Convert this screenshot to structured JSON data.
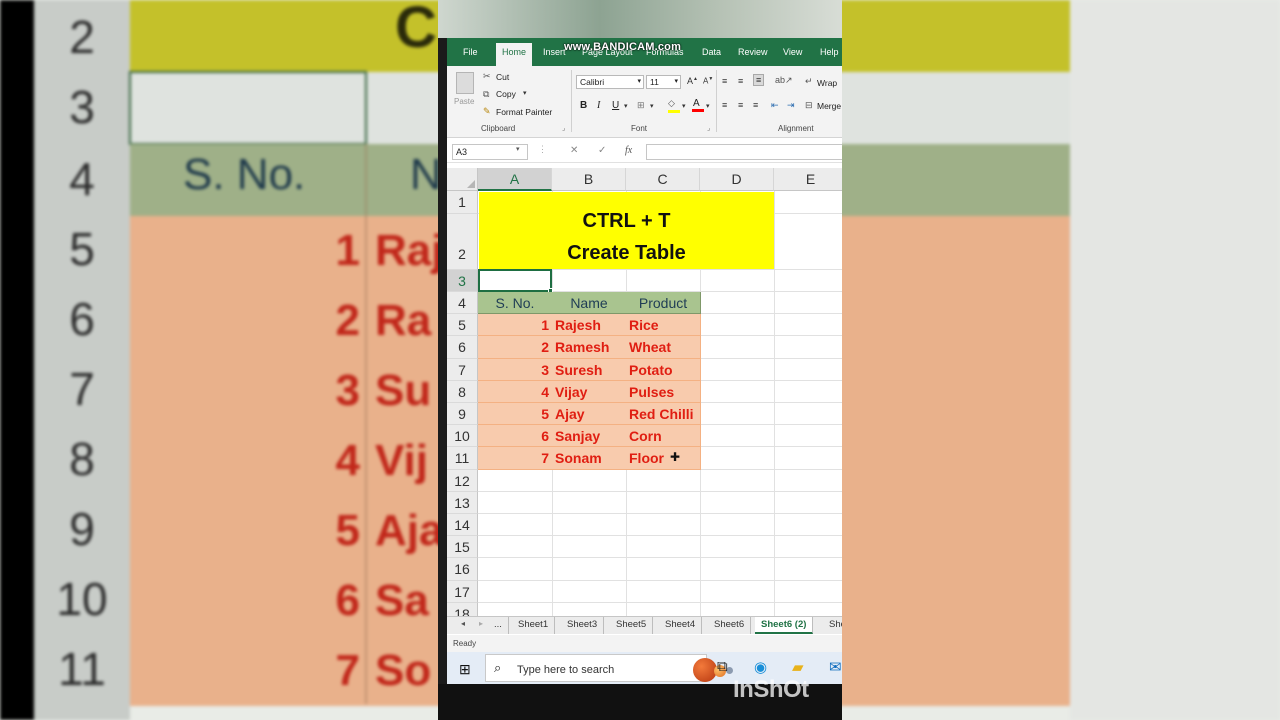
{
  "background": {
    "row_numbers": [
      "2",
      "3",
      "4",
      "5",
      "6",
      "7",
      "8",
      "9",
      "10",
      "11"
    ],
    "title_fragment": "C",
    "header_sno": "S. No.",
    "header_name_fragment": "N",
    "numbers": [
      "1",
      "2",
      "3",
      "4",
      "5",
      "6",
      "7"
    ],
    "name_fragments": [
      "Raj",
      "Ra",
      "Su",
      "Vij",
      "Aja",
      "Sa",
      "So"
    ]
  },
  "watermark": "www.BANDICAM.com",
  "ribbon": {
    "tabs": [
      "File",
      "Home",
      "Insert",
      "Page Layout",
      "Formulas",
      "Data",
      "Review",
      "View",
      "Help"
    ],
    "active_tab": "Home",
    "clipboard": {
      "paste": "Paste",
      "cut": "Cut",
      "copy": "Copy",
      "format_painter": "Format Painter",
      "group_label": "Clipboard"
    },
    "font": {
      "name": "Calibri",
      "size": "11",
      "bold": "B",
      "italic": "I",
      "underline": "U",
      "group_label": "Font"
    },
    "alignment": {
      "wrap": "Wrap",
      "merge": "Merge",
      "group_label": "Alignment"
    }
  },
  "formula_bar": {
    "name_box": "A3",
    "fx": "fx",
    "value": ""
  },
  "grid": {
    "columns": [
      "A",
      "B",
      "C",
      "D",
      "E"
    ],
    "selected_column": "A",
    "rows": [
      "1",
      "2",
      "3",
      "4",
      "5",
      "6",
      "7",
      "8",
      "9",
      "10",
      "11",
      "12",
      "13",
      "14",
      "15",
      "16",
      "17",
      "18"
    ],
    "selected_row": "3",
    "title_line1": "CTRL + T",
    "title_line2": "Create Table",
    "table_headers": [
      "S. No.",
      "Name",
      "Product"
    ],
    "table_rows": [
      [
        "1",
        "Rajesh",
        "Rice"
      ],
      [
        "2",
        "Ramesh",
        "Wheat"
      ],
      [
        "3",
        "Suresh",
        "Potato"
      ],
      [
        "4",
        "Vijay",
        "Pulses"
      ],
      [
        "5",
        "Ajay",
        "Red Chilli"
      ],
      [
        "6",
        "Sanjay",
        "Corn"
      ],
      [
        "7",
        "Sonam",
        "Floor"
      ]
    ]
  },
  "sheet_tabs": {
    "ellipsis": "...",
    "tabs": [
      "Sheet1",
      "Sheet3",
      "Sheet5",
      "Sheet4",
      "Sheet6",
      "Sheet6 (2)",
      "She"
    ],
    "active": "Sheet6 (2)"
  },
  "status": "Ready",
  "taskbar": {
    "search_placeholder": "Type here to search"
  },
  "inshot_watermark": "InShOt",
  "colors": {
    "excel_green": "#217346",
    "title_yellow": "#ffff00",
    "header_green": "#a9c48f",
    "row_orange": "#f8cbad",
    "text_red": "#e01e12"
  }
}
